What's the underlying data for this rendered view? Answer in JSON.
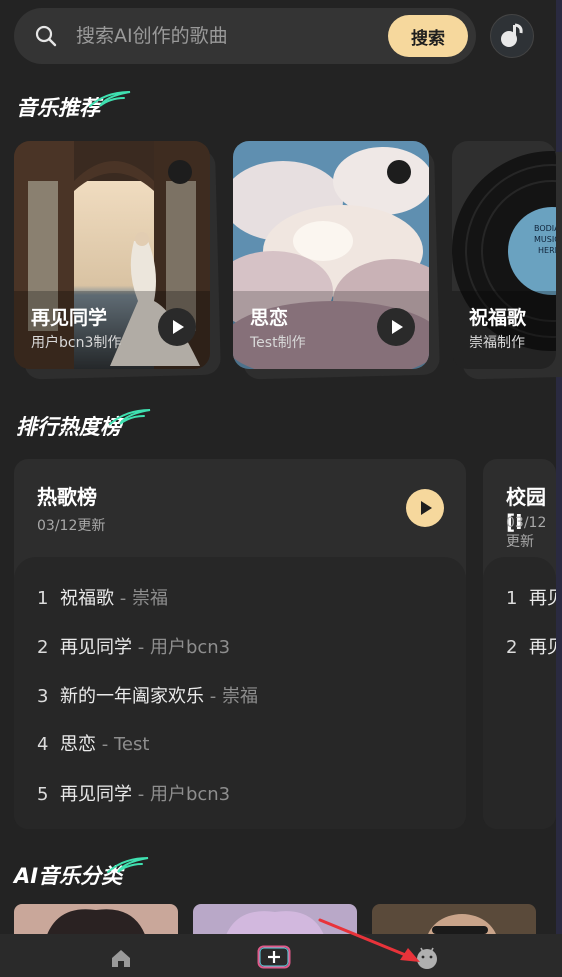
{
  "search": {
    "placeholder": "搜索AI创作的歌曲",
    "button": "搜索"
  },
  "sections": {
    "recommend": "音乐推荐",
    "ranking": "排行热度榜",
    "category": "AI音乐分类"
  },
  "recommend": [
    {
      "title": "再见同学",
      "sub": "用户bcn3制作"
    },
    {
      "title": "思恋",
      "sub": "Test制作"
    },
    {
      "title": "祝福歌",
      "sub": "崇福制作"
    }
  ],
  "vinyl_label": [
    "BODIA",
    "MUSIC",
    "HERE"
  ],
  "charts": [
    {
      "title": "热歌榜",
      "date": "03/12更新",
      "items": [
        {
          "n": "1",
          "song": "祝福歌",
          "artist": "- 崇福"
        },
        {
          "n": "2",
          "song": "再见同学",
          "artist": "- 用户bcn3"
        },
        {
          "n": "3",
          "song": "新的一年阖家欢乐",
          "artist": "- 崇福"
        },
        {
          "n": "4",
          "song": "思恋",
          "artist": "- Test"
        },
        {
          "n": "5",
          "song": "再见同学",
          "artist": "- 用户bcn3"
        }
      ]
    },
    {
      "title": "校园[I",
      "date": "03/12更新",
      "items": [
        {
          "n": "1",
          "song": "再见"
        },
        {
          "n": "2",
          "song": "再见"
        }
      ]
    }
  ],
  "nav": {
    "home": "home-icon",
    "create": "add-icon",
    "profile": "android-icon"
  },
  "colors": {
    "accent": "#f6d89d",
    "swoosh": "#3fe0b0",
    "background": "#232323",
    "arrow": "#e8333a"
  }
}
